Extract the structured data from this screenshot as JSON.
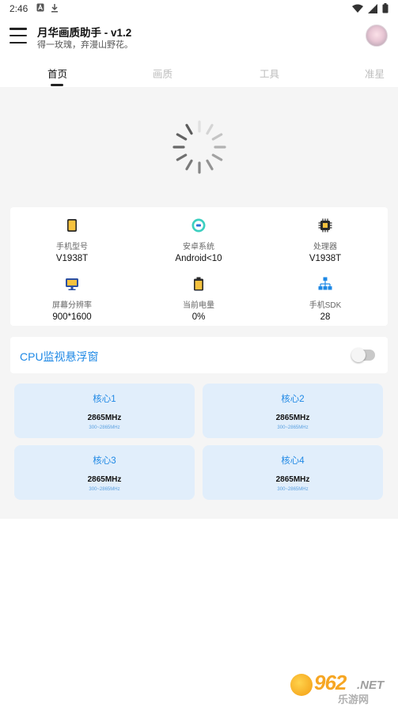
{
  "status_bar": {
    "time": "2:46"
  },
  "app_bar": {
    "title": "月华画质助手 - v1.2",
    "subtitle": "得一玫瑰，弃漫山野花。"
  },
  "tabs": [
    {
      "label": "首页",
      "active": true
    },
    {
      "label": "画质",
      "active": false
    },
    {
      "label": "工具",
      "active": false
    },
    {
      "label": "准星",
      "active": false
    }
  ],
  "device_info": [
    {
      "icon": "phone-icon",
      "label": "手机型号",
      "value": "V1938T"
    },
    {
      "icon": "android-icon",
      "label": "安卓系统",
      "value": "Android<10"
    },
    {
      "icon": "chip-icon",
      "label": "处理器",
      "value": "V1938T"
    },
    {
      "icon": "monitor-icon",
      "label": "屏幕分辨率",
      "value": "900*1600"
    },
    {
      "icon": "battery-icon",
      "label": "当前电量",
      "value": "0%"
    },
    {
      "icon": "network-icon",
      "label": "手机SDK",
      "value": "28"
    }
  ],
  "cpu_monitor": {
    "label": "CPU监视悬浮窗",
    "enabled": false
  },
  "cores": [
    {
      "name": "核心1",
      "freq": "2865MHz",
      "range": "300~2865MHz"
    },
    {
      "name": "核心2",
      "freq": "2865MHz",
      "range": "300~2865MHz"
    },
    {
      "name": "核心3",
      "freq": "2865MHz",
      "range": "300~2865MHz"
    },
    {
      "name": "核心4",
      "freq": "2865MHz",
      "range": "300~2865MHz"
    }
  ],
  "watermark": {
    "brand": "962",
    "domain": ".NET",
    "site": "乐游网"
  },
  "colors": {
    "accent": "#1e88e5",
    "core_bg": "#e1eefb",
    "main_bg": "#f5f5f5"
  }
}
